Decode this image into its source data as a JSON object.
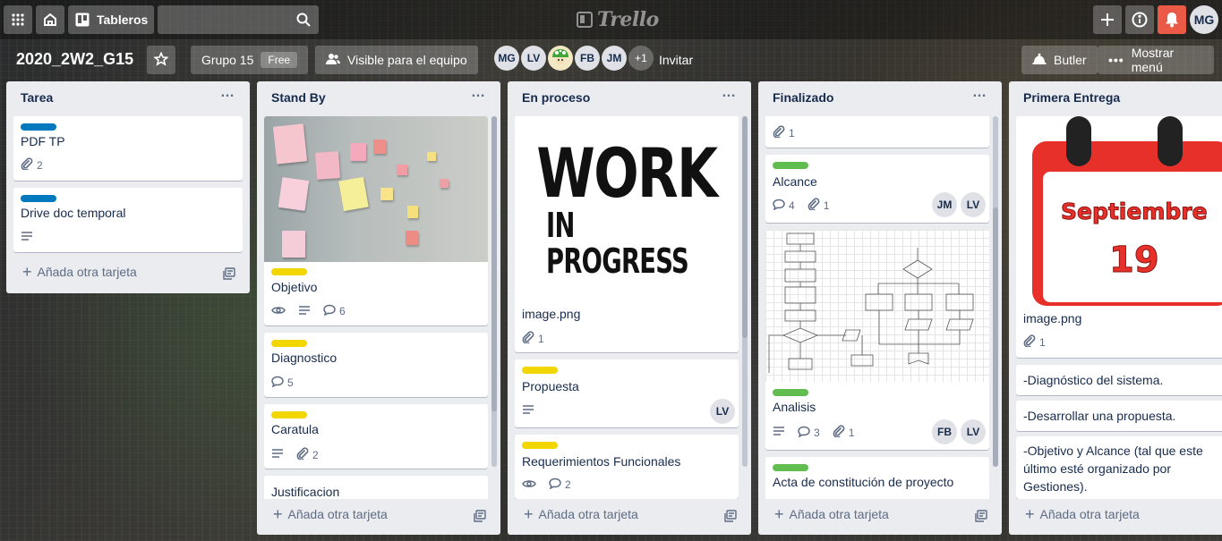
{
  "nav": {
    "boards_label": "Tableros",
    "logo_text": "Trello",
    "user_initials": "MG"
  },
  "board": {
    "title": "2020_2W2_G15",
    "team": "Grupo 15",
    "plan": "Free",
    "visibility": "Visible para el equipo",
    "members": [
      "MG",
      "LV",
      "",
      "FB",
      "JM"
    ],
    "members_more": "+1",
    "invite_label": "Invitar",
    "butler_label": "Butler",
    "menu_label": "Mostrar menú"
  },
  "add_card_label": "Añada otra tarjeta",
  "lists": [
    {
      "title": "Tarea",
      "cards": [
        {
          "label": "blue",
          "title": "PDF TP",
          "attachments": "2"
        },
        {
          "label": "blue",
          "title": "Drive doc temporal",
          "description": true
        }
      ]
    },
    {
      "title": "Stand By",
      "cards": [
        {
          "cover": "sticky-notes",
          "label": "yellow",
          "title": "Objetivo",
          "watching": true,
          "description": true,
          "comments": "6"
        },
        {
          "label": "yellow",
          "title": "Diagnostico",
          "comments": "5"
        },
        {
          "label": "yellow",
          "title": "Caratula",
          "description": true,
          "attachments": "2"
        },
        {
          "title": "Justificacion"
        }
      ]
    },
    {
      "title": "En proceso",
      "cards": [
        {
          "cover": "work-in-progress",
          "cover_text": [
            "WORK",
            "IN PROGRESS"
          ],
          "title": "image.png",
          "attachments": "1"
        },
        {
          "label": "yellow",
          "title": "Propuesta",
          "description": true,
          "members": [
            "LV"
          ]
        },
        {
          "label": "yellow",
          "title": "Requerimientos Funcionales",
          "watching": true,
          "comments": "2"
        }
      ]
    },
    {
      "title": "Finalizado",
      "cards": [
        {
          "attachments": "1"
        },
        {
          "label": "green",
          "title": "Alcance",
          "comments": "4",
          "attachments": "1",
          "members": [
            "JM",
            "LV"
          ]
        },
        {
          "cover": "flowchart",
          "label": "green",
          "title": "Analisis",
          "description": true,
          "comments": "3",
          "attachments": "1",
          "members": [
            "FB",
            "LV"
          ]
        },
        {
          "label": "green",
          "title": "Acta de constitución de proyecto"
        }
      ]
    },
    {
      "title": "Primera Entrega",
      "cards": [
        {
          "cover": "calendar",
          "cover_text": [
            "Septiembre",
            "19"
          ],
          "title": "image.png",
          "attachments": "1"
        },
        {
          "title": "-Diagnóstico del sistema."
        },
        {
          "title": "-Desarrollar una propuesta."
        },
        {
          "title": "-Objetivo y Alcance (tal que este último esté organizado por Gestiones)."
        }
      ]
    }
  ],
  "colors": {
    "label_blue": "#0079bf",
    "label_yellow": "#f2d600",
    "label_green": "#61bd4f",
    "notification": "#eb5a46"
  }
}
